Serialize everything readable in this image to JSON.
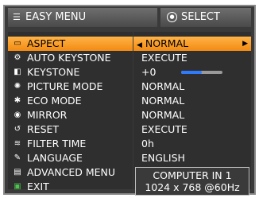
{
  "header": {
    "title": "EASY MENU",
    "menu_icon": "menu-list-icon",
    "select_label": "SELECT",
    "select_icon": "dpad-select-icon"
  },
  "menu": {
    "items": [
      {
        "label": "ASPECT",
        "value": "NORMAL",
        "icon": "aspect-icon",
        "selected": true
      },
      {
        "label": "AUTO KEYSTONE",
        "value": "EXECUTE",
        "icon": "auto-keystone-icon"
      },
      {
        "label": "KEYSTONE",
        "value": "+0",
        "icon": "keystone-icon"
      },
      {
        "label": "PICTURE MODE",
        "value": "NORMAL",
        "icon": "picture-mode-icon"
      },
      {
        "label": "ECO MODE",
        "value": "NORMAL",
        "icon": "eco-mode-icon"
      },
      {
        "label": "MIRROR",
        "value": "NORMAL",
        "icon": "mirror-icon"
      },
      {
        "label": "RESET",
        "value": "EXECUTE",
        "icon": "reset-icon"
      },
      {
        "label": "FILTER TIME",
        "value": "0h",
        "icon": "filter-time-icon"
      },
      {
        "label": "LANGUAGE",
        "value": "ENGLISH",
        "icon": "language-icon"
      },
      {
        "label": "ADVANCED MENU",
        "value": "",
        "icon": "advanced-menu-icon"
      },
      {
        "label": "EXIT",
        "value": "",
        "icon": "exit-icon"
      }
    ],
    "keystone_level": 0.5
  },
  "info": {
    "source": "COMPUTER IN 1",
    "resolution": "1024 x 768 @60Hz"
  },
  "colors": {
    "highlight": "#f28a12",
    "keystone_bar": "#2f7bff"
  }
}
